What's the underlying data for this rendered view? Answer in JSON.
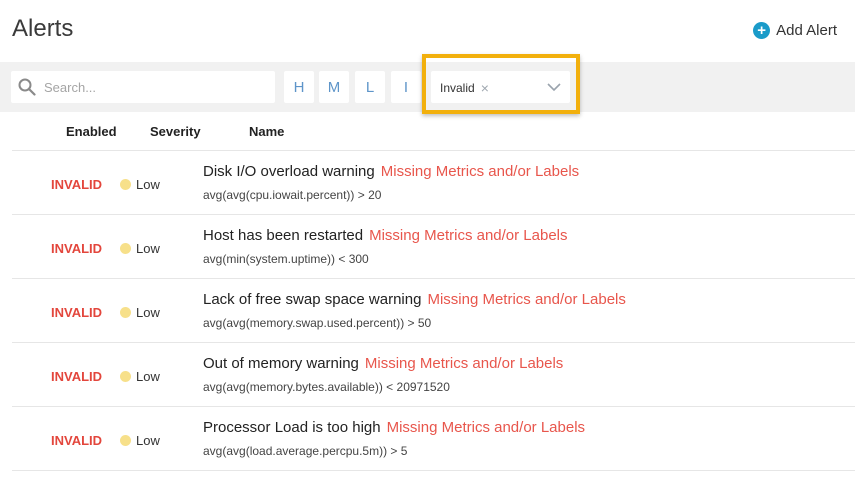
{
  "header": {
    "title": "Alerts",
    "add_alert_label": "Add Alert"
  },
  "filters": {
    "search_placeholder": "Search...",
    "severity_buttons": [
      "H",
      "M",
      "L",
      "I"
    ],
    "status_selected": "Invalid",
    "chip_remove": "×"
  },
  "columns": {
    "enabled": "Enabled",
    "severity": "Severity",
    "name": "Name"
  },
  "alerts": [
    {
      "status": "INVALID",
      "severity": "Low",
      "name": "Disk I/O overload warning",
      "error": "Missing Metrics and/or Labels",
      "expression": "avg(avg(cpu.iowait.percent)) > 20"
    },
    {
      "status": "INVALID",
      "severity": "Low",
      "name": "Host has been restarted",
      "error": "Missing Metrics and/or Labels",
      "expression": "avg(min(system.uptime)) < 300"
    },
    {
      "status": "INVALID",
      "severity": "Low",
      "name": "Lack of free swap space warning",
      "error": "Missing Metrics and/or Labels",
      "expression": "avg(avg(memory.swap.used.percent)) > 50"
    },
    {
      "status": "INVALID",
      "severity": "Low",
      "name": "Out of memory warning",
      "error": "Missing Metrics and/or Labels",
      "expression": "avg(avg(memory.bytes.available)) < 20971520"
    },
    {
      "status": "INVALID",
      "severity": "Low",
      "name": "Processor Load is too high",
      "error": "Missing Metrics and/or Labels",
      "expression": "avg(avg(load.average.percpu.5m)) > 5"
    }
  ],
  "colors": {
    "accent": "#1a9bc9",
    "invalid": "#e3463c",
    "low_severity": "#f7e08a",
    "highlight": "#f2b00d"
  }
}
